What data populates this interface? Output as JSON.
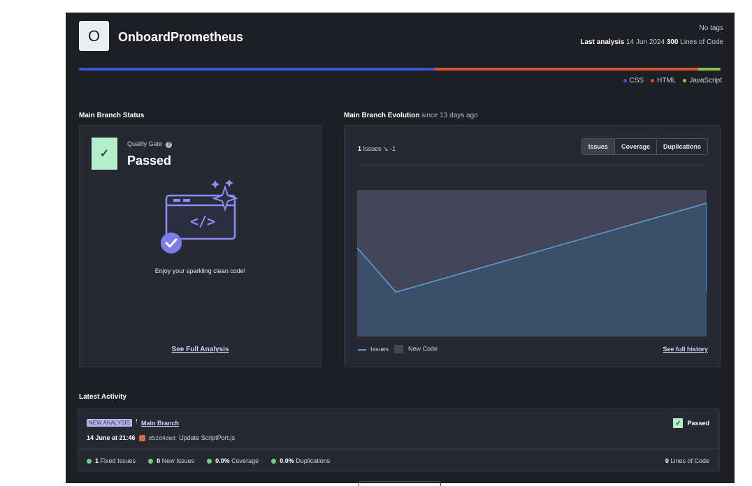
{
  "project": {
    "avatar_letter": "O",
    "name": "OnboardPrometheus",
    "tags": "No tags",
    "last_analysis_label": "Last analysis",
    "last_analysis_date": "14 Jun 2024",
    "lines_of_code": "300",
    "lines_of_code_label": "Lines of Code"
  },
  "languages": [
    {
      "name": "CSS",
      "share": 0.555,
      "color": "#3a56d4"
    },
    {
      "name": "HTML",
      "share": 0.41,
      "color": "#d5532c"
    },
    {
      "name": "JavaScript",
      "share": 0.035,
      "color": "#8fc14a"
    }
  ],
  "main_branch_status": {
    "title": "Main Branch Status",
    "quality_gate_label": "Quality Gate",
    "quality_gate_status": "Passed",
    "message": "Enjoy your sparkling clean code!",
    "see_full_analysis": "See Full Analysis"
  },
  "evolution": {
    "title": "Main Branch Evolution",
    "since": "since 13 days ago",
    "issues_count": "1",
    "issues_label": "Issues",
    "issues_delta": "↘ -1",
    "tabs": [
      "Issues",
      "Coverage",
      "Duplications"
    ],
    "legend_issues": "Issues",
    "legend_new_code": "New Code",
    "see_full_history": "See full history"
  },
  "chart_data": {
    "type": "area",
    "series": [
      {
        "name": "Issues",
        "values": [
          2,
          1,
          3,
          1
        ]
      }
    ],
    "x": [
      0,
      1,
      9,
      9
    ],
    "ylim": [
      0,
      3.3
    ],
    "new_code_period": true
  },
  "activity": {
    "title": "Latest Activity",
    "badge": "NEW ANALYSIS",
    "branch": "Main Branch",
    "datetime": "14 June at 21:46",
    "commit_hash": "d52d4ded",
    "commit_message": "Update ScriptPort.js",
    "status": "Passed",
    "metrics": [
      {
        "value": "1",
        "label": "Fixed Issues"
      },
      {
        "value": "0",
        "label": "New Issues"
      },
      {
        "value": "0.0%",
        "label": "Coverage"
      },
      {
        "value": "0.0%",
        "label": "Duplications"
      }
    ],
    "loc_value": "0",
    "loc_label": "Lines of Code"
  }
}
